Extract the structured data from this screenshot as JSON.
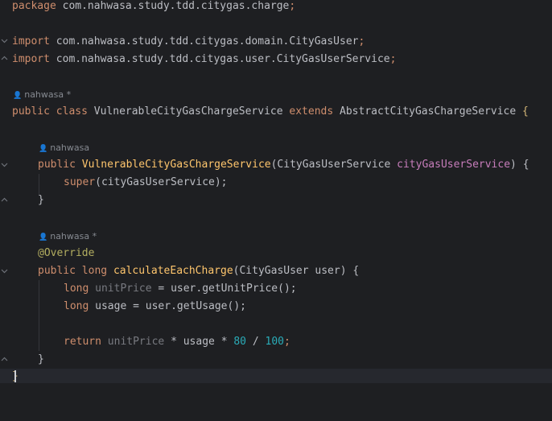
{
  "editor": {
    "package_line": {
      "kw": "package",
      "name": " com.nahwasa.study.tdd.citygas.charge",
      "semi": ";"
    },
    "import1": {
      "kw": "import",
      "name": " com.nahwasa.study.tdd.citygas.domain.CityGasUser",
      "semi": ";"
    },
    "import2": {
      "kw": "import",
      "name": " com.nahwasa.study.tdd.citygas.user.CityGasUserService",
      "semi": ";"
    },
    "hint_class": "nahwasa *",
    "class_decl": {
      "public": "public",
      "class": " class ",
      "name": "VulnerableCityGasChargeService",
      "extends": " extends ",
      "parent": "AbstractCityGasChargeService",
      "brace": " {"
    },
    "hint_ctor": "nahwasa",
    "ctor": {
      "public": "public ",
      "name": "VulnerableCityGasChargeService",
      "args": "(CityGasUserService ",
      "param": "cityGasUserService",
      "end": ") {"
    },
    "super_call": {
      "kw": "super",
      "args": "(cityGasUserService);"
    },
    "close_ctor": "}",
    "hint_method": "nahwasa *",
    "annotation": "@Override",
    "method": {
      "public": "public ",
      "long": "long ",
      "name": "calculateEachCharge",
      "args": "(CityGasUser user) {"
    },
    "line_unit": {
      "long": "long ",
      "var": "unitPrice",
      "rest": " = user.getUnitPrice();"
    },
    "line_usage": {
      "long": "long ",
      "var": "usage",
      "rest": " = user.getUsage();"
    },
    "line_return": {
      "kw": "return ",
      "var1": "unitPrice",
      "op1": " * ",
      "var2": "usage",
      "op2": " * ",
      "n1": "80",
      "op3": " / ",
      "n2": "100",
      "semi": ";"
    },
    "close_method": "}",
    "close_class": "}"
  }
}
